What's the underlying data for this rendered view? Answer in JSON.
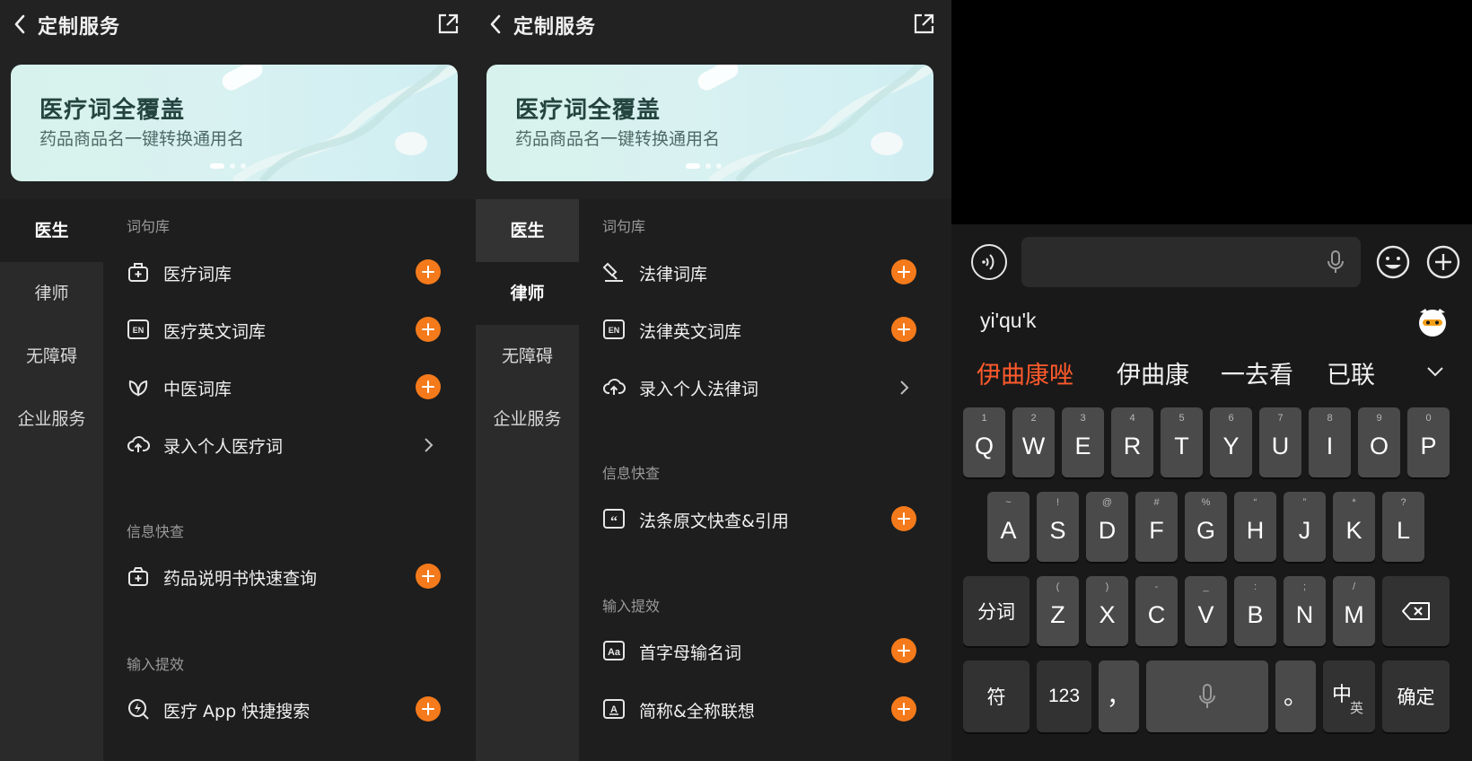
{
  "screen1": {
    "header": {
      "title": "定制服务"
    },
    "banner": {
      "title": "医疗词全覆盖",
      "subtitle": "药品商品名一键转换通用名"
    },
    "sidebar": [
      "医生",
      "律师",
      "无障碍",
      "企业服务"
    ],
    "sections": {
      "lexicon": "词句库",
      "info": "信息快查",
      "boost": "输入提效"
    },
    "rows": {
      "r1": "医疗词库",
      "r2": "医疗英文词库",
      "r3": "中医词库",
      "r4": "录入个人医疗词",
      "r5": "药品说明书快速查询",
      "r6": "医疗 App 快捷搜索"
    }
  },
  "screen2": {
    "header": {
      "title": "定制服务"
    },
    "banner": {
      "title": "医疗词全覆盖",
      "subtitle": "药品商品名一键转换通用名"
    },
    "sidebar": [
      "医生",
      "律师",
      "无障碍",
      "企业服务"
    ],
    "sections": {
      "lexicon": "词句库",
      "info": "信息快查",
      "boost": "输入提效"
    },
    "rows": {
      "r1": "法律词库",
      "r2": "法律英文词库",
      "r3": "录入个人法律词",
      "r4": "法条原文快查&引用",
      "r5": "首字母输名词",
      "r6": "简称&全称联想"
    }
  },
  "keyboard": {
    "pinyin": "yi'qu'k",
    "candidates": [
      "伊曲康唑",
      "伊曲康",
      "一去看",
      "已联"
    ],
    "row1": [
      {
        "k": "Q",
        "s": "1"
      },
      {
        "k": "W",
        "s": "2"
      },
      {
        "k": "E",
        "s": "3"
      },
      {
        "k": "R",
        "s": "4"
      },
      {
        "k": "T",
        "s": "5"
      },
      {
        "k": "Y",
        "s": "6"
      },
      {
        "k": "U",
        "s": "7"
      },
      {
        "k": "I",
        "s": "8"
      },
      {
        "k": "O",
        "s": "9"
      },
      {
        "k": "P",
        "s": "0"
      }
    ],
    "row2": [
      {
        "k": "A",
        "s": "~"
      },
      {
        "k": "S",
        "s": "!"
      },
      {
        "k": "D",
        "s": "@"
      },
      {
        "k": "F",
        "s": "#"
      },
      {
        "k": "G",
        "s": "%"
      },
      {
        "k": "H",
        "s": "“"
      },
      {
        "k": "J",
        "s": "”"
      },
      {
        "k": "K",
        "s": "*"
      },
      {
        "k": "L",
        "s": "?"
      }
    ],
    "row3": [
      {
        "k": "Z",
        "s": "("
      },
      {
        "k": "X",
        "s": ")"
      },
      {
        "k": "C",
        "s": "-"
      },
      {
        "k": "V",
        "s": "_"
      },
      {
        "k": "B",
        "s": ":"
      },
      {
        "k": "N",
        "s": ";"
      },
      {
        "k": "M",
        "s": "/"
      }
    ],
    "segment": "分词",
    "symbols": "符",
    "numbers": "123",
    "comma": "，",
    "period": "。",
    "lang_main": "中",
    "lang_alt": "英",
    "confirm": "确定"
  },
  "colors": {
    "accent": "#f47a1b",
    "candidate_highlight": "#ff5a2c",
    "banner_bg": "#d7f2ec"
  }
}
